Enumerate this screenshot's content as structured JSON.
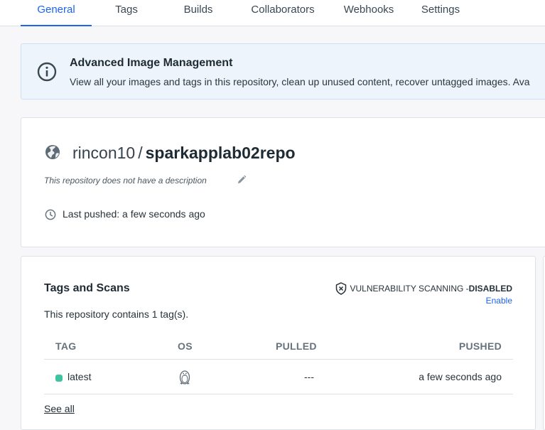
{
  "tabs": [
    {
      "label": "General",
      "active": true
    },
    {
      "label": "Tags",
      "active": false
    },
    {
      "label": "Builds",
      "active": false
    },
    {
      "label": "Collaborators",
      "active": false
    },
    {
      "label": "Webhooks",
      "active": false
    },
    {
      "label": "Settings",
      "active": false
    }
  ],
  "banner": {
    "icon": "info-icon",
    "title": "Advanced Image Management",
    "text": "View all your images and tags in this repository, clean up unused content, recover untagged images. Ava"
  },
  "repo": {
    "visibility_icon": "globe-icon",
    "namespace": "rincon10",
    "separator": "/",
    "name": "sparkapplab02repo",
    "description": "This repository does not have a description",
    "last_pushed": "Last pushed: a few seconds ago"
  },
  "tags_section": {
    "title": "Tags and Scans",
    "count_text": "This repository contains 1 tag(s).",
    "vuln_label": "VULNERABILITY SCANNING - ",
    "vuln_status": "DISABLED",
    "enable_label": "Enable",
    "columns": {
      "tag": "TAG",
      "os": "OS",
      "pulled": "PULLED",
      "pushed": "PUSHED"
    },
    "rows": [
      {
        "tag": "latest",
        "os_icon": "linux-tux-icon",
        "pulled": "---",
        "pushed": "a few seconds ago",
        "status_color": "#3ec4a0"
      }
    ],
    "see_all": "See all"
  },
  "colors": {
    "accent": "#1d63ed",
    "banner_bg": "#edf4fc",
    "tag_status": "#3ec4a0"
  }
}
